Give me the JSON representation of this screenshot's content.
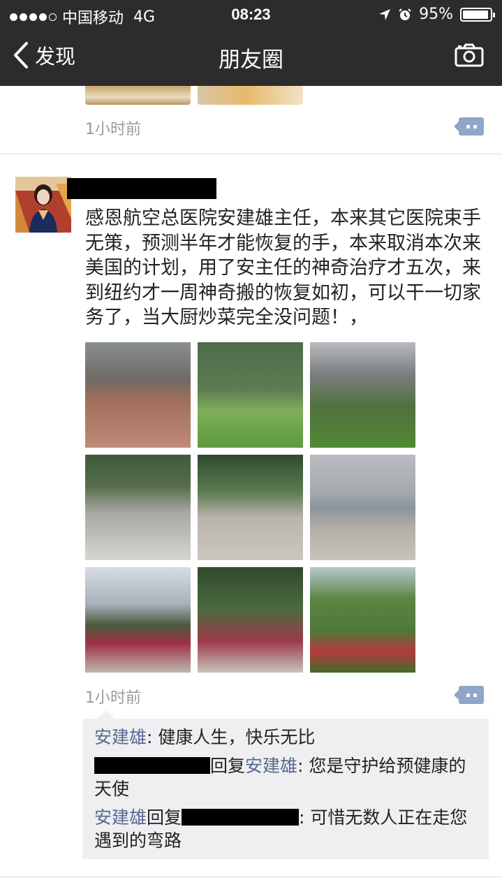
{
  "status_bar": {
    "carrier": "中国移动",
    "network": "4G",
    "time": "08:23",
    "battery": "95%",
    "battery_level": 0.95
  },
  "nav": {
    "back_label": "发现",
    "title": "朋友圈"
  },
  "previous_post": {
    "time": "1小时前"
  },
  "post": {
    "text": "感恩航空总医院安建雄主任，本来其它医院束手无策，预测半年才能恢复的手，本来取消本次来美国的计划，用了安主任的神奇治疗才五次，来到纽约才一周神奇搬的恢复如初，可以干一切家务了，当大厨炒菜完全没问题！，",
    "photo_count": 9,
    "time": "1小时前",
    "comments": [
      {
        "author": "安建雄",
        "separator": ": ",
        "text": "健康人生，快乐无比"
      },
      {
        "reply_word": "回复",
        "target": "安建雄",
        "separator": ": ",
        "text": "您是守护给预健康的天使"
      },
      {
        "author": "安建雄",
        "reply_word": "回复",
        "separator": ": ",
        "text": "可惜无数人正在走您遇到的弯路"
      }
    ]
  },
  "colors": {
    "nav_background": "#2c2c2e",
    "name_link": "#56698f",
    "comment_background": "#efeff2",
    "comment_button": "#8fa6c8"
  }
}
